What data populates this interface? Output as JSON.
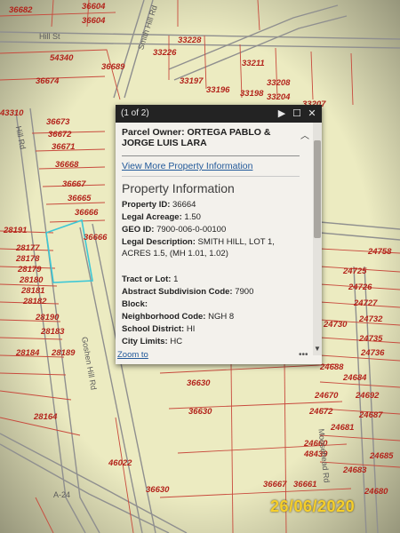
{
  "map": {
    "parcel_labels": [
      "36682",
      "36604",
      "54340",
      "36689",
      "36674",
      "43310",
      "36673",
      "36672",
      "36671",
      "36668",
      "36667",
      "36665",
      "36666",
      "36666",
      "28191",
      "28177",
      "28178",
      "28179",
      "28180",
      "28181",
      "28182",
      "28190",
      "28183",
      "28184",
      "28189",
      "28184",
      "28164",
      "36630",
      "36642",
      "36652",
      "36630",
      "46022",
      "36630",
      "33228",
      "33226",
      "33197",
      "33196",
      "33198",
      "33211",
      "33208",
      "33204",
      "33207",
      "24758",
      "24725",
      "24726",
      "24727",
      "24732",
      "24730",
      "24735",
      "24736",
      "24688",
      "24684",
      "24670",
      "24672",
      "24692",
      "24687",
      "24681",
      "24683",
      "24685",
      "24680",
      "24660",
      "48439",
      "36667",
      "36661"
    ],
    "road_labels": [
      "Hill St",
      "Hill Rd",
      "Smith Hill Rd",
      "Goshen Hill Rd",
      "Moosehead Rd",
      "A-24"
    ]
  },
  "popup": {
    "counter": "(1 of 2)",
    "owner_title": "Parcel Owner: ORTEGA PABLO & JORGE LUIS LARA",
    "view_more_link": "View More Property Information",
    "section_title": "Property Information",
    "fields": [
      {
        "label": "Property ID:",
        "value": "36664"
      },
      {
        "label": "Legal Acreage:",
        "value": "1.50"
      },
      {
        "label": "GEO ID:",
        "value": "7900-006-0-00100"
      },
      {
        "label": "Legal Description:",
        "value": "SMITH HILL, LOT 1, ACRES 1.5, (MH 1.01, 1.02)"
      },
      {
        "label": "Tract or Lot:",
        "value": "1"
      },
      {
        "label": "Abstract Subdivision Code:",
        "value": "7900"
      },
      {
        "label": "Block:",
        "value": ""
      },
      {
        "label": "Neighborhood Code:",
        "value": "NGH 8"
      },
      {
        "label": "School District:",
        "value": "HI"
      },
      {
        "label": "City Limits:",
        "value": "HC"
      }
    ],
    "zoom_link": "Zoom to",
    "more_dots": "•••",
    "icons": {
      "next": "play-icon",
      "maximize": "maximize-icon",
      "close": "close-icon",
      "collapse": "chevron-up-icon",
      "scroll_down": "chevron-down-icon"
    }
  },
  "date_stamp": "26/06/2020"
}
